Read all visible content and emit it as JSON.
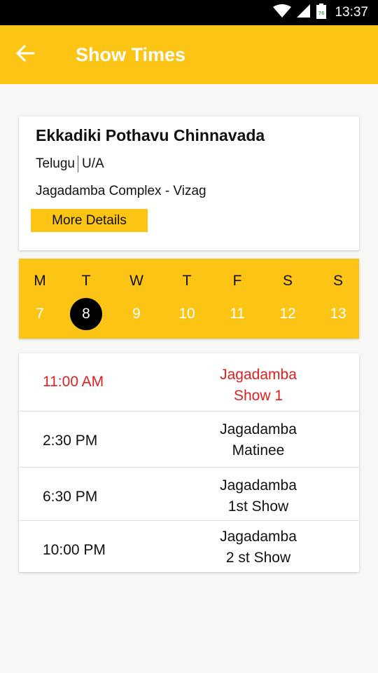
{
  "status_bar": {
    "time": "13:37",
    "battery_level": "76"
  },
  "app_bar": {
    "title": "Show Times"
  },
  "movie": {
    "title": "Ekkadiki Pothavu Chinnavada",
    "language": "Telugu",
    "certificate": "U/A",
    "venue": "Jagadamba Complex - Vizag",
    "more_details_label": "More Details"
  },
  "calendar": {
    "days": [
      {
        "letter": "M",
        "num": "7"
      },
      {
        "letter": "T",
        "num": "8"
      },
      {
        "letter": "W",
        "num": "9"
      },
      {
        "letter": "T",
        "num": "10"
      },
      {
        "letter": "F",
        "num": "11"
      },
      {
        "letter": "S",
        "num": "12"
      },
      {
        "letter": "S",
        "num": "13"
      }
    ],
    "selected_index": 1
  },
  "shows": [
    {
      "time": "11:00 AM",
      "name_line1": "Jagadamba",
      "name_line2": "Show 1"
    },
    {
      "time": "2:30 PM",
      "name_line1": "Jagadamba",
      "name_line2": "Matinee"
    },
    {
      "time": "6:30 PM",
      "name_line1": "Jagadamba",
      "name_line2": "1st Show"
    },
    {
      "time": "10:00 PM",
      "name_line1": "Jagadamba",
      "name_line2": "2 st Show"
    }
  ],
  "colors": {
    "accent": "#fcc515",
    "highlight": "#e02020",
    "status_bar": "#000000"
  },
  "icons": {
    "back": "arrow-left-icon",
    "wifi": "wifi-icon",
    "signal": "cell-signal-icon",
    "battery": "battery-icon"
  }
}
